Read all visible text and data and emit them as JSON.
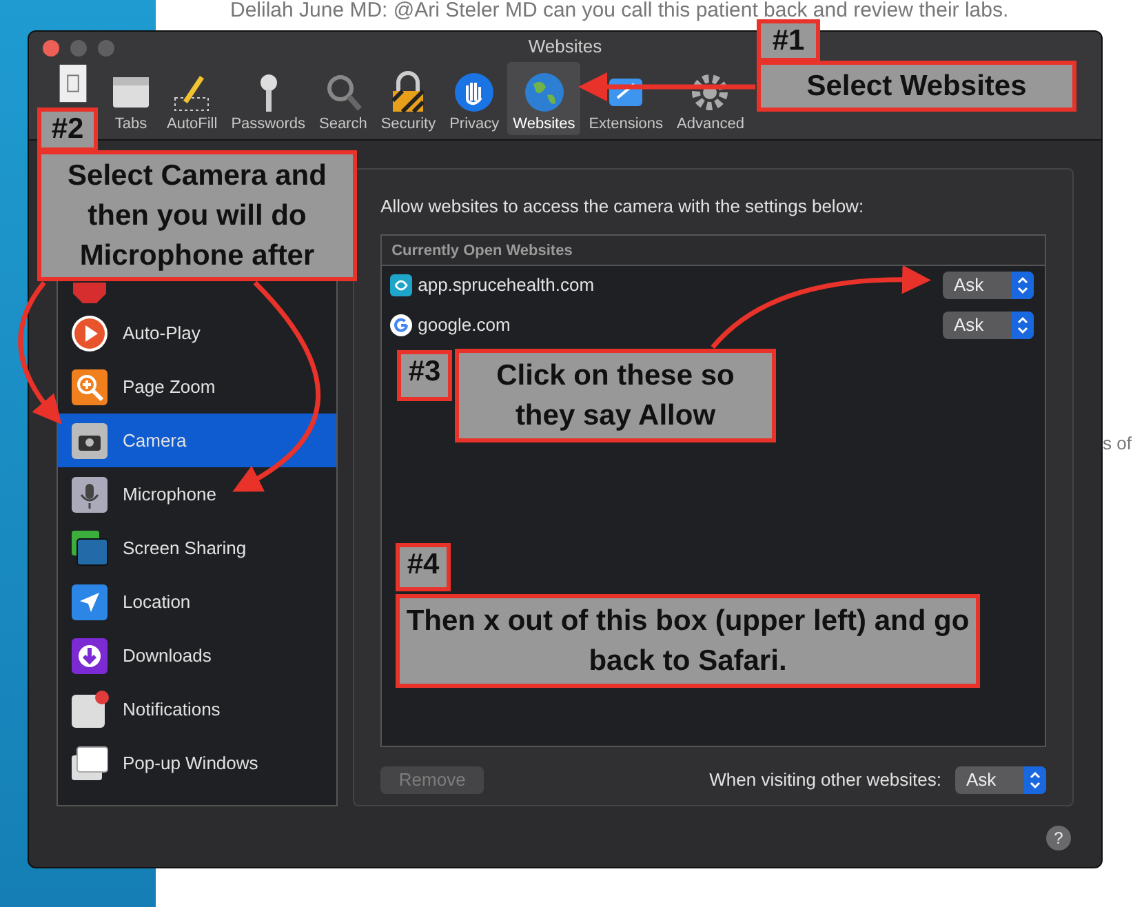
{
  "background": {
    "message": "Delilah June MD: @Ari Steler MD can you call this patient back and review their labs.",
    "side_text": "s of"
  },
  "window": {
    "title": "Websites"
  },
  "toolbar": [
    {
      "selected": false
    },
    {
      "label": "Tabs",
      "selected": false
    },
    {
      "label": "AutoFill",
      "selected": false
    },
    {
      "label": "Passwords",
      "selected": false
    },
    {
      "label": "Search",
      "selected": false
    },
    {
      "label": "Security",
      "selected": false
    },
    {
      "label": "Privacy",
      "selected": false
    },
    {
      "label": "Websites",
      "selected": true
    },
    {
      "label": "Extensions",
      "selected": false
    },
    {
      "label": "Advanced",
      "selected": false
    }
  ],
  "sidebar": {
    "items": [
      {
        "selected": false
      },
      {
        "label": "Auto-Play",
        "selected": false
      },
      {
        "label": "Page Zoom",
        "selected": false
      },
      {
        "label": "Camera",
        "selected": true
      },
      {
        "label": "Microphone",
        "selected": false
      },
      {
        "label": "Screen Sharing",
        "selected": false
      },
      {
        "label": "Location",
        "selected": false
      },
      {
        "label": "Downloads",
        "selected": false
      },
      {
        "label": "Notifications",
        "selected": false
      },
      {
        "label": "Pop-up Windows",
        "selected": false
      }
    ]
  },
  "main": {
    "description": "Allow websites to access the camera with the settings below:",
    "table": {
      "header": "Currently Open Websites",
      "rows": [
        {
          "site": "app.sprucehealth.com",
          "setting": "Ask"
        },
        {
          "site": "google.com",
          "setting": "Ask"
        }
      ]
    },
    "remove_button": {
      "label": "Remove",
      "disabled": true
    },
    "other_label": "When visiting other websites:",
    "other_setting": "Ask",
    "help": "?"
  },
  "annotations": [
    {
      "number": "#1",
      "text": "Select Websites"
    },
    {
      "number": "#2",
      "text": "Select Camera and then you will do Microphone after"
    },
    {
      "number": "#3",
      "text": "Click on these so they say Allow"
    },
    {
      "number": "#4",
      "text": "Then x out of this box (upper left) and go back to Safari."
    }
  ]
}
